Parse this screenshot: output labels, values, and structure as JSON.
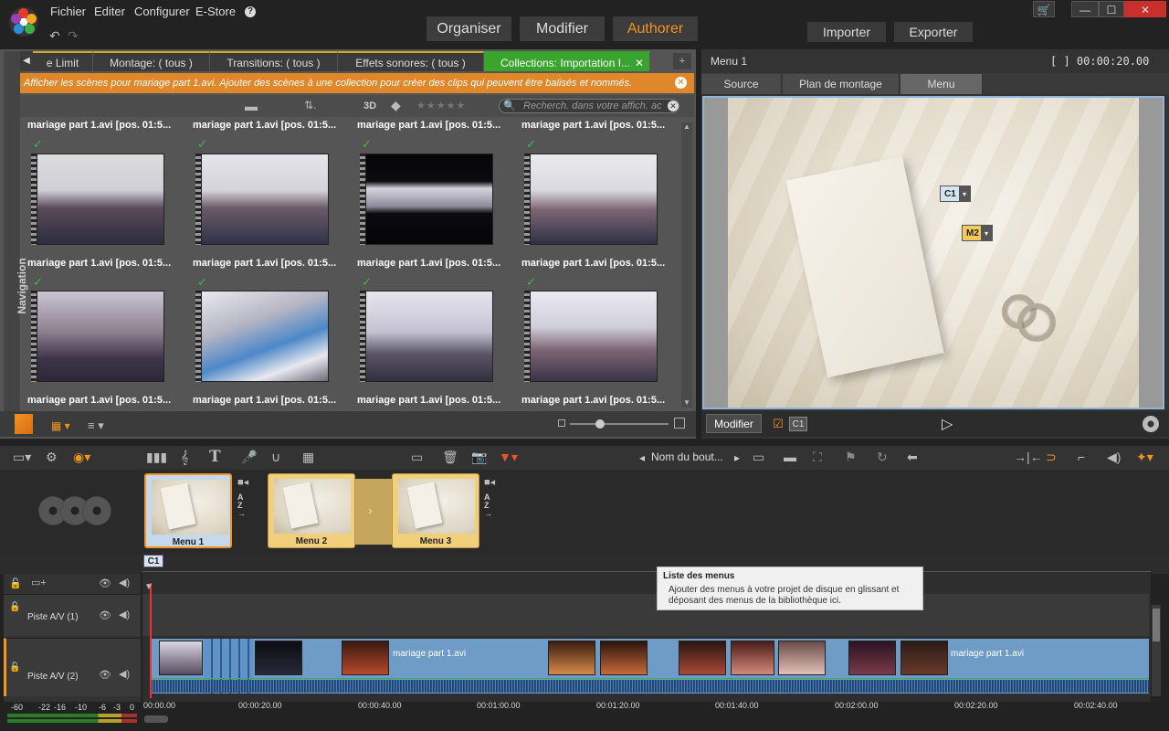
{
  "menubar": {
    "items": [
      "Fichier",
      "Editer",
      "Configurer",
      "E-Store"
    ],
    "help": "?"
  },
  "modes": {
    "organiser": "Organiser",
    "modifier": "Modifier",
    "authorer": "Authorer"
  },
  "io": {
    "importer": "Importer",
    "exporter": "Exporter"
  },
  "window": {
    "minimize": "—",
    "maximize": "☐",
    "close": "✕"
  },
  "library": {
    "navigation_label": "Navigation",
    "tabs": [
      "e Limit",
      "Montage: ( tous )",
      "Transitions: ( tous )",
      "Effets sonores: ( tous )",
      "Collections: Importation I..."
    ],
    "info": "Afficher les scènes pour mariage part 1.avi. Ajouter des scènes à une collection pour créer des clips qui peuvent être balisés et nommés.",
    "toolbar_3d": "3D",
    "search_placeholder": "Recherch. dans votre affich. ac",
    "items": [
      {
        "label": "mariage part 1.avi [pos. 01:5..."
      },
      {
        "label": "mariage part 1.avi [pos. 01:5..."
      },
      {
        "label": "mariage part 1.avi [pos. 01:5..."
      },
      {
        "label": "mariage part 1.avi [pos. 01:5..."
      },
      {
        "label": "mariage part 1.avi [pos. 01:5..."
      },
      {
        "label": "mariage part 1.avi [pos. 01:5..."
      },
      {
        "label": "mariage part 1.avi [pos. 01:5..."
      },
      {
        "label": "mariage part 1.avi [pos. 01:5..."
      },
      {
        "label": "mariage part 1.avi [pos. 01:5..."
      },
      {
        "label": "mariage part 1.avi [pos. 01:5..."
      },
      {
        "label": "mariage part 1.avi [pos. 01:5..."
      },
      {
        "label": "mariage part 1.avi [pos. 01:5..."
      }
    ]
  },
  "preview": {
    "title": "Menu 1",
    "timecode": "[ ] 00:00:20.00",
    "tabs": [
      "Source",
      "Plan de montage",
      "Menu"
    ],
    "chip_c1": "C1",
    "chip_m2": "M2",
    "modify_button": "Modifier",
    "chapter_badge": "C1"
  },
  "timeline": {
    "nav_label": "Nom du bout...",
    "menus": [
      {
        "label": "Menu 1"
      },
      {
        "label": "Menu 2"
      },
      {
        "label": "Menu 3"
      }
    ],
    "chapter_marker": "C1",
    "tracks": [
      {
        "name": "Piste A/V (1)"
      },
      {
        "name": "Piste A/V (2)"
      }
    ],
    "clip_labels": [
      "mariage part 1.avi",
      "mariage part 1.avi"
    ],
    "ticks": [
      "00:00.00",
      "00:00:20.00",
      "00:00:40.00",
      "00:01:00.00",
      "00:01:20.00",
      "00:01:40.00",
      "00:02:00.00",
      "00:02:20.00",
      "00:02:40.00"
    ],
    "vu_scale": [
      "-60",
      "-22",
      "-16",
      "-10",
      "-6",
      "-3",
      "0"
    ],
    "tooltip": {
      "title": "Liste des menus",
      "body": "Ajouter des menus à votre projet de disque en glissant et déposant des menus de la bibliothèque ici."
    }
  }
}
